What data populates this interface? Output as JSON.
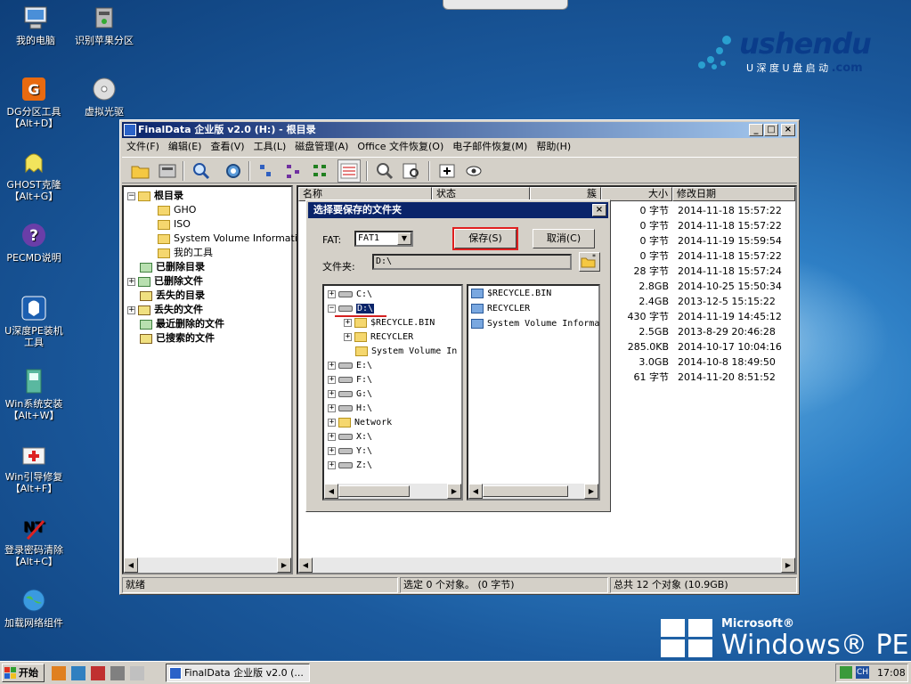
{
  "desktop": {
    "icons": [
      {
        "label1": "我的电脑",
        "label2": ""
      },
      {
        "label1": "识别苹果分区",
        "label2": ""
      },
      {
        "label1": "DG分区工具",
        "label2": "【Alt+D】"
      },
      {
        "label1": "虚拟光驱",
        "label2": ""
      },
      {
        "label1": "GHOST克隆",
        "label2": "【Alt+G】"
      },
      {
        "label1": "PECMD说明",
        "label2": ""
      },
      {
        "label1": "U深度PE装机",
        "label2": "工具"
      },
      {
        "label1": "Win系统安装",
        "label2": "【Alt+W】"
      },
      {
        "label1": "Win引导修复",
        "label2": "【Alt+F】"
      },
      {
        "label1": "登录密码清除",
        "label2": "【Alt+C】"
      },
      {
        "label1": "加载网络组件",
        "label2": ""
      }
    ],
    "logo_text": "ushendu",
    "logo_sub": "U 深 度  U 盘 启 动",
    "logo_com": ".com",
    "pe_ms": "Microsoft®",
    "pe_name": "Windows® PE"
  },
  "window": {
    "title": "FinalData 企业版 v2.0 (H:) - 根目录",
    "menu": [
      "文件(F)",
      "编辑(E)",
      "查看(V)",
      "工具(L)",
      "磁盘管理(A)",
      "Office 文件恢复(O)",
      "电子邮件恢复(M)",
      "帮助(H)"
    ],
    "tree": [
      {
        "label": "根目录",
        "bold": true
      },
      {
        "label": "GHO"
      },
      {
        "label": "ISO"
      },
      {
        "label": "System Volume Information"
      },
      {
        "label": "我的工具"
      },
      {
        "label": "已删除目录",
        "bold": true
      },
      {
        "label": "已删除文件",
        "bold": true
      },
      {
        "label": "丢失的目录",
        "bold": true
      },
      {
        "label": "丢失的文件",
        "bold": true
      },
      {
        "label": "最近删除的文件",
        "bold": true
      },
      {
        "label": "已搜索的文件",
        "bold": true
      }
    ],
    "columns": {
      "name": "名称",
      "status": "状态",
      "cluster": "簇",
      "size": "大小",
      "date": "修改日期"
    },
    "rows": [
      {
        "size": "0 字节",
        "date": "2014-11-18 15:57:22"
      },
      {
        "size": "0 字节",
        "date": "2014-11-18 15:57:22"
      },
      {
        "size": "0 字节",
        "date": "2014-11-19 15:59:54"
      },
      {
        "size": "0 字节",
        "date": "2014-11-18 15:57:22"
      },
      {
        "size": "28 字节",
        "date": "2014-11-18 15:57:24"
      },
      {
        "size": "2.8GB",
        "date": "2014-10-25 15:50:34"
      },
      {
        "size": "2.4GB",
        "date": "2013-12-5 15:15:22"
      },
      {
        "size": "430 字节",
        "date": "2014-11-19 14:45:12"
      },
      {
        "size": "2.5GB",
        "date": "2013-8-29 20:46:28"
      },
      {
        "size": "285.0KB",
        "date": "2014-10-17 10:04:16"
      },
      {
        "size": "3.0GB",
        "date": "2014-10-8 18:49:50"
      },
      {
        "size": "61 字节",
        "date": "2014-11-20 8:51:52"
      }
    ],
    "status": {
      "left": "就绪",
      "middle": "选定 0 个对象。 (0 字节)",
      "right": "总共 12 个对象 (10.9GB)"
    }
  },
  "dialog": {
    "title": "选择要保存的文件夹",
    "fat_label": "FAT:",
    "fat_value": "FAT1",
    "save": "保存(S)",
    "cancel": "取消(C)",
    "folder_label": "文件夹:",
    "folder_value": "D:\\",
    "tree": [
      "C:\\",
      "D:\\",
      "$RECYCLE.BIN",
      "RECYCLER",
      "System Volume In",
      "E:\\",
      "F:\\",
      "G:\\",
      "H:\\",
      "Network",
      "X:\\",
      "Y:\\",
      "Z:\\"
    ],
    "list": [
      "$RECYCLE.BIN",
      "RECYCLER",
      "System Volume Informa"
    ]
  },
  "taskbar": {
    "start": "开始",
    "task": "FinalData 企业版 v2.0 (...",
    "lang": "CH",
    "clock": "17:08"
  },
  "colors": {
    "titlebar": "#0a246a",
    "face": "#d4d0c8",
    "highlight": "#e02020"
  }
}
